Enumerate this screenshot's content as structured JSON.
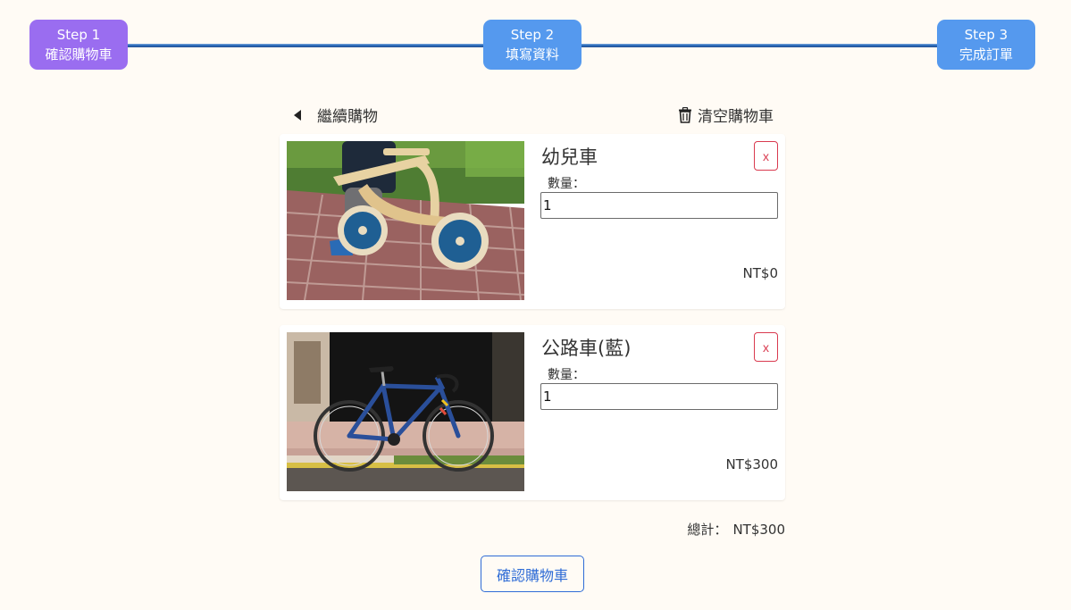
{
  "stepper": {
    "steps": [
      {
        "step": "Step 1",
        "label": "確認購物車",
        "state": "active",
        "color": "#9a6df0"
      },
      {
        "step": "Step 2",
        "label": "填寫資料",
        "state": "pending",
        "color": "#5599ee"
      },
      {
        "step": "Step 3",
        "label": "完成訂單",
        "state": "pending",
        "color": "#5599ee"
      }
    ]
  },
  "actions": {
    "back_label": "繼續購物",
    "clear_label": "清空購物車"
  },
  "cart": {
    "qty_label": "數量：",
    "remove_label": "x",
    "items": [
      {
        "name": "幼兒車",
        "quantity": "1",
        "price": "NT$0",
        "image": "balance-bike-photo"
      },
      {
        "name": "公路車(藍)",
        "quantity": "1",
        "price": "NT$300",
        "image": "road-bike-photo"
      }
    ]
  },
  "summary": {
    "total_label": "總計：",
    "total_value": "NT$300",
    "confirm_label": "確認購物車"
  },
  "colors": {
    "background": "#fffbf5",
    "accent_active": "#9a6df0",
    "accent_step": "#5599ee",
    "danger": "#d93a4f",
    "primary": "#2f6cd6"
  }
}
